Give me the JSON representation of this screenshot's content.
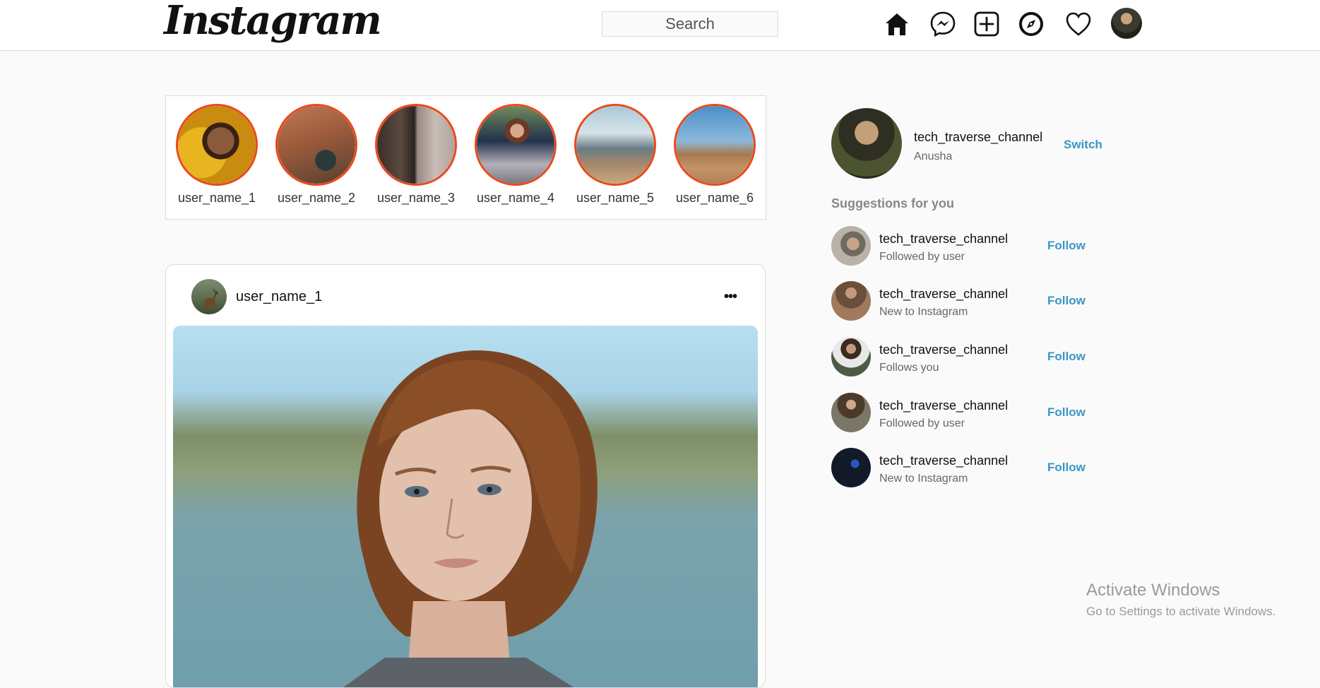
{
  "header": {
    "logo_text": "Instagram",
    "search_placeholder": "Search",
    "nav_icons": [
      "home-icon",
      "messenger-icon",
      "new-post-icon",
      "explore-icon",
      "heart-icon",
      "profile-avatar"
    ]
  },
  "stories": [
    {
      "username": "user_name_1"
    },
    {
      "username": "user_name_2"
    },
    {
      "username": "user_name_3"
    },
    {
      "username": "user_name_4"
    },
    {
      "username": "user_name_5"
    },
    {
      "username": "user_name_6"
    }
  ],
  "story_ring_color": "#e8491d",
  "post": {
    "username": "user_name_1",
    "more_label": "•••"
  },
  "sidebar": {
    "me": {
      "username": "tech_traverse_channel",
      "name": "Anusha",
      "switch_label": "Switch"
    },
    "suggestions_title": "Suggestions for you",
    "follow_label": "Follow",
    "suggestions": [
      {
        "username": "tech_traverse_channel",
        "subtitle": "Followed by user"
      },
      {
        "username": "tech_traverse_channel",
        "subtitle": "New to Instagram"
      },
      {
        "username": "tech_traverse_channel",
        "subtitle": "Follows you"
      },
      {
        "username": "tech_traverse_channel",
        "subtitle": "Followed by user"
      },
      {
        "username": "tech_traverse_channel",
        "subtitle": "New to Instagram"
      }
    ]
  },
  "link_color": "#3897c7",
  "watermark": {
    "title": "Activate Windows",
    "subtitle": "Go to Settings to activate Windows."
  }
}
